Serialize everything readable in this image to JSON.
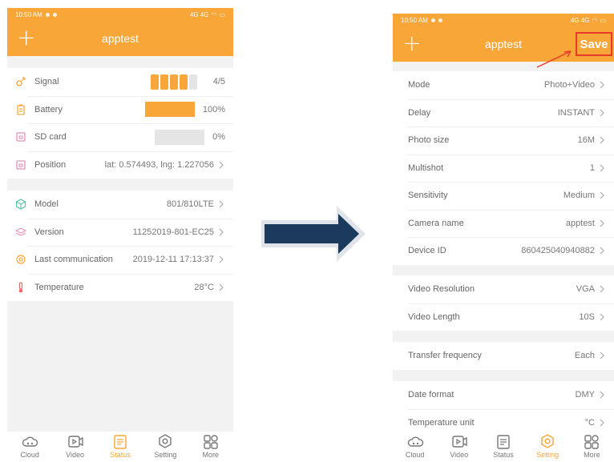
{
  "status_bar": {
    "time": "10:50 AM",
    "right": "4G 4G"
  },
  "left": {
    "title": "apptest",
    "status_rows": [
      {
        "label": "Signal",
        "value": "4/5",
        "bars_on": 4,
        "bars_total": 5
      },
      {
        "label": "Battery",
        "value": "100%",
        "fill": 1.0
      },
      {
        "label": "SD card",
        "value": "0%",
        "fill": 0.0
      },
      {
        "label": "Position",
        "value": "lat: 0.574493, lng: 1.227056"
      }
    ],
    "info_rows": [
      {
        "label": "Model",
        "value": "801/810LTE"
      },
      {
        "label": "Version",
        "value": "11252019-801-EC25"
      },
      {
        "label": "Last communication",
        "value": "2019-12-11 17:13:37"
      },
      {
        "label": "Temperature",
        "value": "28°C"
      }
    ]
  },
  "right": {
    "title": "apptest",
    "save_label": "Save",
    "group1": [
      {
        "label": "Mode",
        "value": "Photo+Video"
      },
      {
        "label": "Delay",
        "value": "INSTANT"
      },
      {
        "label": "Photo size",
        "value": "16M"
      },
      {
        "label": "Multishot",
        "value": "1"
      },
      {
        "label": "Sensitivity",
        "value": "Medium"
      },
      {
        "label": "Camera name",
        "value": "apptest"
      },
      {
        "label": "Device ID",
        "value": "860425040940882"
      }
    ],
    "group2": [
      {
        "label": "Video Resolution",
        "value": "VGA"
      },
      {
        "label": "Video Length",
        "value": "10S"
      }
    ],
    "group3": [
      {
        "label": "Transfer frequency",
        "value": "Each"
      }
    ],
    "group4": [
      {
        "label": "Date format",
        "value": "DMY"
      },
      {
        "label": "Temperature unit",
        "value": "°C"
      }
    ]
  },
  "tabs": [
    {
      "label": "Cloud",
      "icon": "cloud-icon"
    },
    {
      "label": "Video",
      "icon": "video-icon"
    },
    {
      "label": "Status",
      "icon": "status-icon"
    },
    {
      "label": "Setting",
      "icon": "setting-icon"
    },
    {
      "label": "More",
      "icon": "more-icon"
    }
  ],
  "left_active_tab": 2,
  "right_active_tab": 3,
  "colors": {
    "accent": "#f7a637",
    "highlight": "#e63a2b",
    "arrow": "#1c3a5e"
  }
}
